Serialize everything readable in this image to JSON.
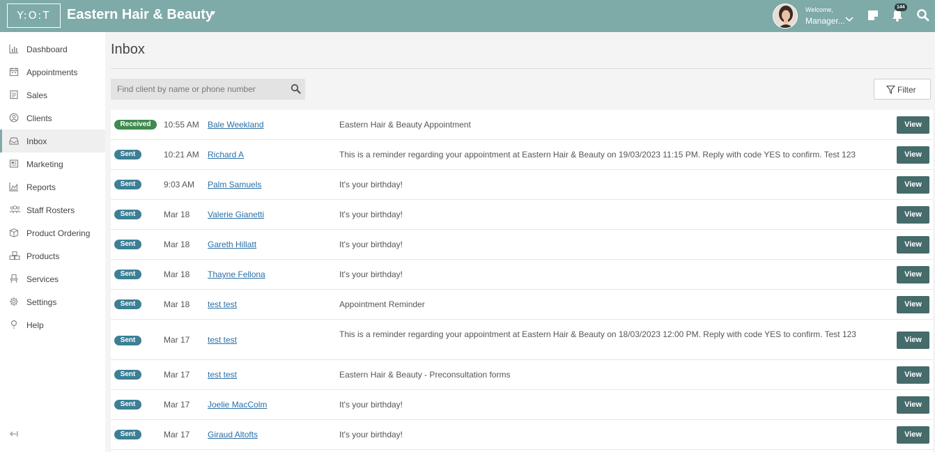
{
  "header": {
    "logo_text": "Y:O:T",
    "business_name": "Eastern Hair & Beauty",
    "welcome_text": "Welcome,",
    "user_name": "Manager...",
    "notification_count": "144",
    "icons": [
      "notes-icon",
      "bell-icon",
      "search-icon"
    ]
  },
  "sidebar": {
    "items": [
      {
        "label": "Dashboard",
        "icon": "chart-icon"
      },
      {
        "label": "Appointments",
        "icon": "calendar-icon"
      },
      {
        "label": "Sales",
        "icon": "receipt-icon"
      },
      {
        "label": "Clients",
        "icon": "user-circle-icon"
      },
      {
        "label": "Inbox",
        "icon": "inbox-icon",
        "active": true
      },
      {
        "label": "Marketing",
        "icon": "newspaper-icon"
      },
      {
        "label": "Reports",
        "icon": "area-chart-icon"
      },
      {
        "label": "Staff Rosters",
        "icon": "people-icon"
      },
      {
        "label": "Product Ordering",
        "icon": "box-icon"
      },
      {
        "label": "Products",
        "icon": "boxes-icon"
      },
      {
        "label": "Services",
        "icon": "chair-icon"
      },
      {
        "label": "Settings",
        "icon": "gear-icon"
      },
      {
        "label": "Help",
        "icon": "help-icon"
      }
    ]
  },
  "main": {
    "title": "Inbox",
    "search_placeholder": "Find client by name or phone number",
    "filter_label": "Filter",
    "view_label": "View",
    "messages": [
      {
        "status": "Received",
        "time": "10:55 AM",
        "client": "Bale Weekland",
        "text": "Eastern Hair & Beauty Appointment"
      },
      {
        "status": "Sent",
        "time": "10:21 AM",
        "client": "Richard A",
        "text": "This is a reminder regarding your appointment at Eastern Hair & Beauty on 19/03/2023 11:15 PM. Reply with code YES to confirm. Test 123"
      },
      {
        "status": "Sent",
        "time": "9:03 AM",
        "client": "Palm Samuels",
        "text": "It's your birthday!"
      },
      {
        "status": "Sent",
        "time": "Mar 18",
        "client": "Valerie Gianetti",
        "text": "It's your birthday!"
      },
      {
        "status": "Sent",
        "time": "Mar 18",
        "client": "Gareth Hillatt",
        "text": "It's your birthday!"
      },
      {
        "status": "Sent",
        "time": "Mar 18",
        "client": "Thayne Fellona",
        "text": "It's your birthday!"
      },
      {
        "status": "Sent",
        "time": "Mar 18",
        "client": "test test",
        "text": "Appointment Reminder"
      },
      {
        "status": "Sent",
        "time": "Mar 17",
        "client": "test test",
        "text": "This is a reminder regarding your appointment at Eastern Hair & Beauty on 18/03/2023 12:00 PM. Reply with code YES to confirm. Test 123"
      },
      {
        "status": "Sent",
        "time": "Mar 17",
        "client": "test test",
        "text": "Eastern Hair & Beauty - Preconsultation forms"
      },
      {
        "status": "Sent",
        "time": "Mar 17",
        "client": "Joelie MacColm",
        "text": "It's your birthday!"
      },
      {
        "status": "Sent",
        "time": "Mar 17",
        "client": "Giraud Altofts",
        "text": "It's your birthday!"
      }
    ]
  },
  "colors": {
    "header_bg": "#7eaaa8",
    "sent_badge": "#3c7f96",
    "received_badge": "#3f8a4d",
    "view_button": "#456b6a",
    "link": "#2a6fa6"
  }
}
